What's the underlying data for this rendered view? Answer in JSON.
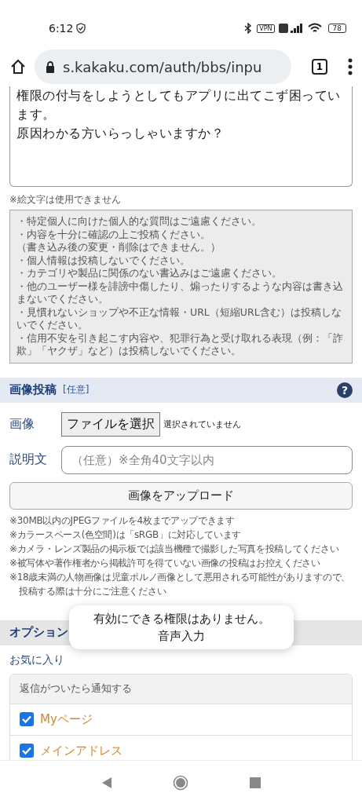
{
  "status_bar": {
    "time": "6:12",
    "vpn": "VPN",
    "battery": "78"
  },
  "browser": {
    "url": "s.kakaku.com/auth/bbs/inpu",
    "tab_count": "1"
  },
  "message": {
    "lines": [
      "権限の付与をしようとしてもアプリに出てこず困っています。",
      "原因わかる方いらっしゃいますか？"
    ]
  },
  "emoji_note": "※絵文字は使用できません",
  "rules": [
    "・特定個人に向けた個人的な質問はご遠慮ください。",
    "・内容を十分に確認の上ご投稿ください。",
    "（書き込み後の変更・削除はできません。）",
    "・個人情報は投稿しないでください。",
    "・カテゴリや製品に関係のない書込みはご遠慮ください。",
    "・他のユーザー様を誹謗中傷したり、煽ったりするような内容は書き込まないでください。",
    "・見慣れないショップや不正な情報・URL（短縮URL含む）は投稿しないでください。",
    "・信用不安を引き起こす内容や、犯罪行為と受け取れる表現（例：「詐欺」「ヤクザ」など）は投稿しないでください。"
  ],
  "image_section": {
    "title": "画像投稿",
    "help": "?",
    "tag": "[任意]",
    "image_label": "画像",
    "file_button": "ファイルを選択",
    "file_status": "選択されていません",
    "caption_label": "説明文",
    "caption_placeholder": "（任意）※全角40文字以内",
    "upload_button": "画像をアップロード",
    "notes": [
      "※30MB以内のJPEGファイルを4枚までアップできます",
      "※カラースペース(色空間)は「sRGB」に対応しています",
      "※カメラ・レンズ製品の掲示板では該当機種で撮影した写真を投稿してください",
      "※被写体や著作権者から掲載許可を得ていない画像の投稿はお控えください",
      "※18歳未満の人物画像は児童ポルノ画像として悪用される可能性がありますので、投稿する際は十分にご注意ください"
    ]
  },
  "options_section": {
    "title": "オプション",
    "subtitle": "お気に入り",
    "card_title": "返信がついたら通知する",
    "items": [
      {
        "label": "Myページ",
        "checked": true
      },
      {
        "label": "メインアドレス",
        "checked": true
      }
    ]
  },
  "toast": {
    "lines": [
      "有効にできる権限はありません。",
      "音声入力"
    ]
  }
}
